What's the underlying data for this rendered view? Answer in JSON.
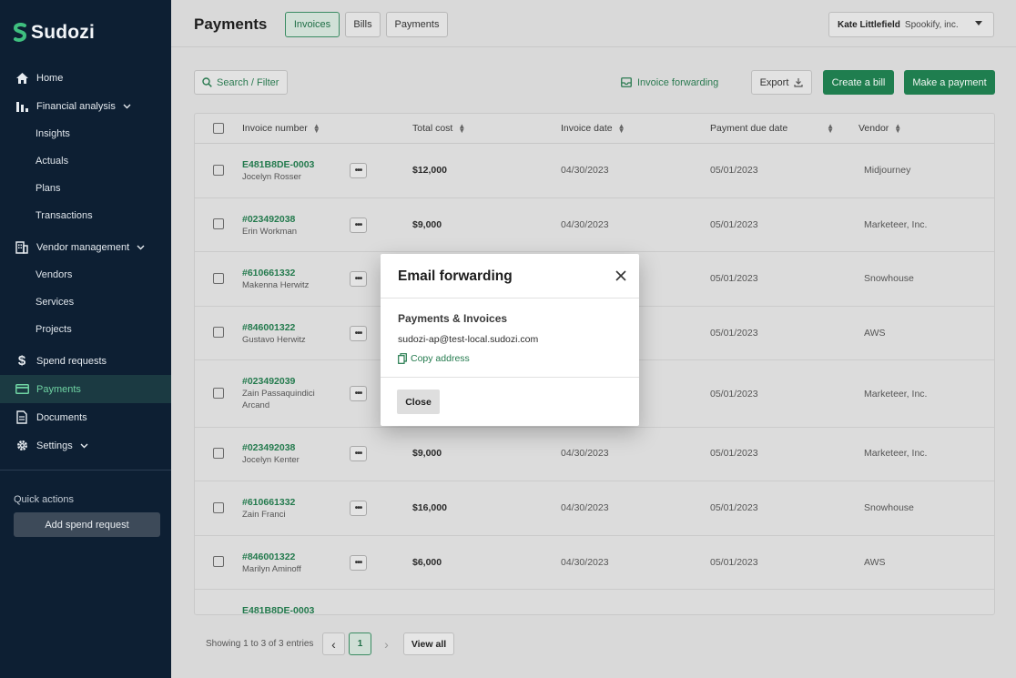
{
  "brand": {
    "name": "Sudozi",
    "accent": "#1f7e4f"
  },
  "sidebar": {
    "nav": [
      {
        "id": "home",
        "label": "Home",
        "icon": "home-icon"
      },
      {
        "id": "financial",
        "label": "Financial analysis",
        "icon": "bar-chart-icon",
        "expandable": true,
        "children": [
          "Insights",
          "Actuals",
          "Plans",
          "Transactions"
        ]
      },
      {
        "id": "vendor",
        "label": "Vendor management",
        "icon": "building-icon",
        "expandable": true,
        "children": [
          "Vendors",
          "Services",
          "Projects"
        ]
      },
      {
        "id": "spend",
        "label": "Spend requests",
        "icon": "dollar-icon"
      },
      {
        "id": "payments",
        "label": "Payments",
        "icon": "credit-card-icon",
        "active": true
      },
      {
        "id": "documents",
        "label": "Documents",
        "icon": "document-icon"
      },
      {
        "id": "settings",
        "label": "Settings",
        "icon": "gear-icon",
        "expandable": true
      }
    ],
    "quick_actions_label": "Quick actions",
    "add_spend_label": "Add spend request"
  },
  "header": {
    "title": "Payments",
    "tabs": [
      {
        "label": "Invoices",
        "active": true
      },
      {
        "label": "Bills",
        "active": false
      },
      {
        "label": "Payments",
        "active": false
      }
    ],
    "user_name": "Kate Littlefield",
    "org_name": "Spookify, inc."
  },
  "toolbar": {
    "search_label": "Search / Filter",
    "forwarding_label": "Invoice forwarding",
    "export_label": "Export",
    "create_bill_label": "Create a bill",
    "make_payment_label": "Make a payment"
  },
  "table": {
    "columns": [
      "Invoice number",
      "Total cost",
      "Invoice date",
      "Payment due date",
      "Vendor"
    ],
    "rows": [
      {
        "number": "E481B8DE-0003",
        "person": "Jocelyn Rosser",
        "cost": "$12,000",
        "invoice_date": "04/30/2023",
        "due_date": "05/01/2023",
        "vendor": "Midjourney"
      },
      {
        "number": "#023492038",
        "person": "Erin Workman",
        "cost": "$9,000",
        "invoice_date": "04/30/2023",
        "due_date": "05/01/2023",
        "vendor": "Marketeer, Inc."
      },
      {
        "number": "#610661332",
        "person": "Makenna Herwitz",
        "cost": "",
        "invoice_date": "",
        "due_date": "05/01/2023",
        "vendor": "Snowhouse"
      },
      {
        "number": "#846001322",
        "person": "Gustavo Herwitz",
        "cost": "",
        "invoice_date": "",
        "due_date": "05/01/2023",
        "vendor": "AWS"
      },
      {
        "number": "#023492039",
        "person": "Zain Passaquindici Arcand",
        "cost": "",
        "invoice_date": "",
        "due_date": "05/01/2023",
        "vendor": "Marketeer, Inc."
      },
      {
        "number": "#023492038",
        "person": "Jocelyn Kenter",
        "cost": "$9,000",
        "invoice_date": "04/30/2023",
        "due_date": "05/01/2023",
        "vendor": "Marketeer, Inc."
      },
      {
        "number": "#610661332",
        "person": "Zain Franci",
        "cost": "$16,000",
        "invoice_date": "04/30/2023",
        "due_date": "05/01/2023",
        "vendor": "Snowhouse"
      },
      {
        "number": "#846001322",
        "person": "Marilyn Aminoff",
        "cost": "$6,000",
        "invoice_date": "04/30/2023",
        "due_date": "05/01/2023",
        "vendor": "AWS"
      },
      {
        "number": "E481B8DE-0003",
        "person": "",
        "cost": "",
        "invoice_date": "",
        "due_date": "",
        "vendor": ""
      }
    ],
    "more_label": "•••"
  },
  "pagination": {
    "summary": "Showing 1 to 3 of 3 entries",
    "prev": "‹",
    "current": "1",
    "next": "›",
    "view_all": "View all"
  },
  "modal": {
    "title": "Email forwarding",
    "subtitle": "Payments & Invoices",
    "email": "sudozi-ap@test-local.sudozi.com",
    "copy_label": "Copy address",
    "close_label": "Close"
  }
}
